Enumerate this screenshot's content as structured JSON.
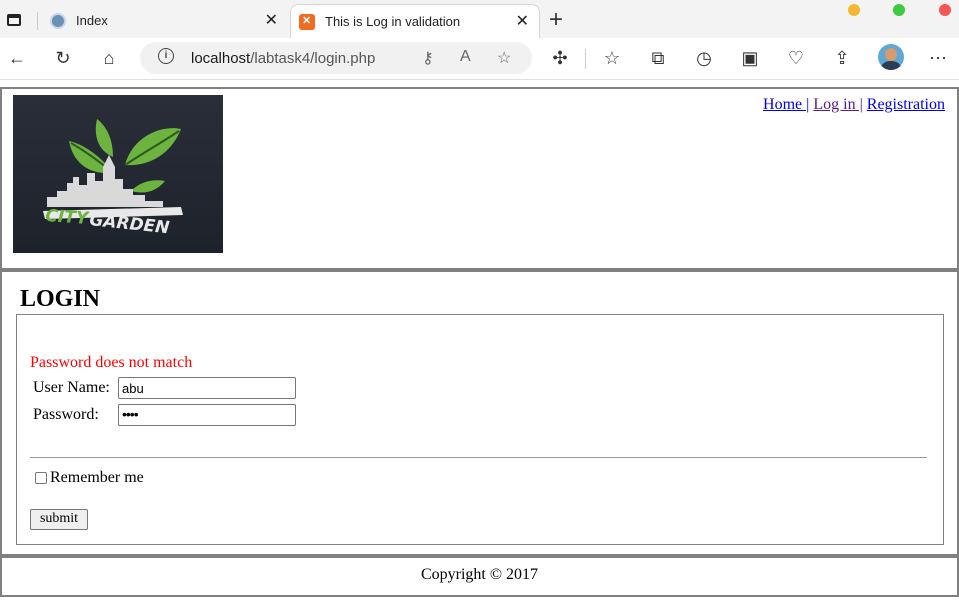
{
  "browser": {
    "tabs": [
      {
        "title": "Index",
        "active": false
      },
      {
        "title": "This is Log in validation",
        "active": true
      }
    ],
    "address": {
      "host": "localhost",
      "path": "/labtask4/login.php"
    },
    "window_controls": {
      "minimize_color": "#f5b731",
      "maximize_color": "#3ec93e",
      "close_color": "#f25656"
    }
  },
  "header": {
    "logo_text": "CITYGARDEN",
    "nav": [
      {
        "label": "Home |"
      },
      {
        "label": "Log in |"
      },
      {
        "label": "Registration"
      }
    ]
  },
  "login": {
    "legend": "LOGIN",
    "error": "Password does not match",
    "username_label": "User Name:",
    "username_value": "abu",
    "password_label": "Password:",
    "password_value": "••••",
    "remember_label": "Remember me",
    "submit_label": "submit"
  },
  "footer": {
    "text": "Copyright © 2017"
  },
  "colors": {
    "error": "#ff0000",
    "link": "#0000ee",
    "visited_link": "#551a8b",
    "logo_green": "#6cb33f"
  }
}
